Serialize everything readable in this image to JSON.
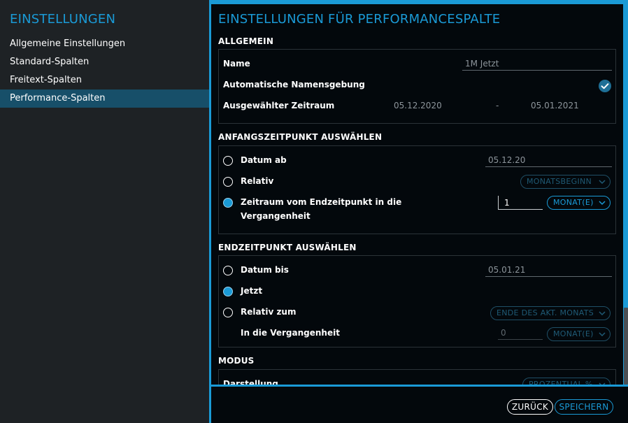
{
  "sidebar": {
    "title": "EINSTELLUNGEN",
    "items": [
      {
        "label": "Allgemeine Einstellungen",
        "active": false
      },
      {
        "label": "Standard-Spalten",
        "active": false
      },
      {
        "label": "Freitext-Spalten",
        "active": false
      },
      {
        "label": "Performance-Spalten",
        "active": true
      }
    ]
  },
  "main": {
    "title": "EINSTELLUNGEN FÜR PERFORMANCESPALTE",
    "allgemein": {
      "header": "ALLGEMEIN",
      "name_label": "Name",
      "name_value": "1M Jetzt",
      "auto_label": "Automatische Namensgebung",
      "auto_checked": true,
      "range_label": "Ausgewählter Zeitraum",
      "range_from": "05.12.2020",
      "range_sep": "-",
      "range_to": "05.01.2021"
    },
    "anfang": {
      "header": "ANFANGSZEITPUNKT AUSWÄHLEN",
      "datum_ab_label": "Datum ab",
      "datum_ab_value": "05.12.20",
      "relativ_label": "Relativ",
      "relativ_select": "MONATSBEGINN",
      "zeitraum_label_line1": "Zeitraum vom Endzeitpunkt in die",
      "zeitraum_label_line2": "Vergangenheit",
      "zeitraum_value": "1",
      "zeitraum_unit": "MONAT(E)",
      "selected": "zeitraum"
    },
    "ende": {
      "header": "ENDZEITPUNKT AUSWÄHLEN",
      "datum_bis_label": "Datum bis",
      "datum_bis_value": "05.01.21",
      "jetzt_label": "Jetzt",
      "relativ_zum_label": "Relativ zum",
      "relativ_zum_select": "ENDE DES AKT. MONATS",
      "vergangenheit_label": "In die Vergangenheit",
      "vergangenheit_value": "0",
      "vergangenheit_unit": "MONAT(E)",
      "selected": "jetzt"
    },
    "modus": {
      "header": "MODUS",
      "darstellung_label": "Darstellung",
      "darstellung_select": "PROZENTUAL %"
    }
  },
  "footer": {
    "back_label": "ZURÜCK",
    "save_label": "SPEICHERN"
  },
  "colors": {
    "accent": "#1a9ad6",
    "panel_bg": "#03080c",
    "sidebar_bg": "#1e2225",
    "active_item_bg": "#174f69"
  }
}
